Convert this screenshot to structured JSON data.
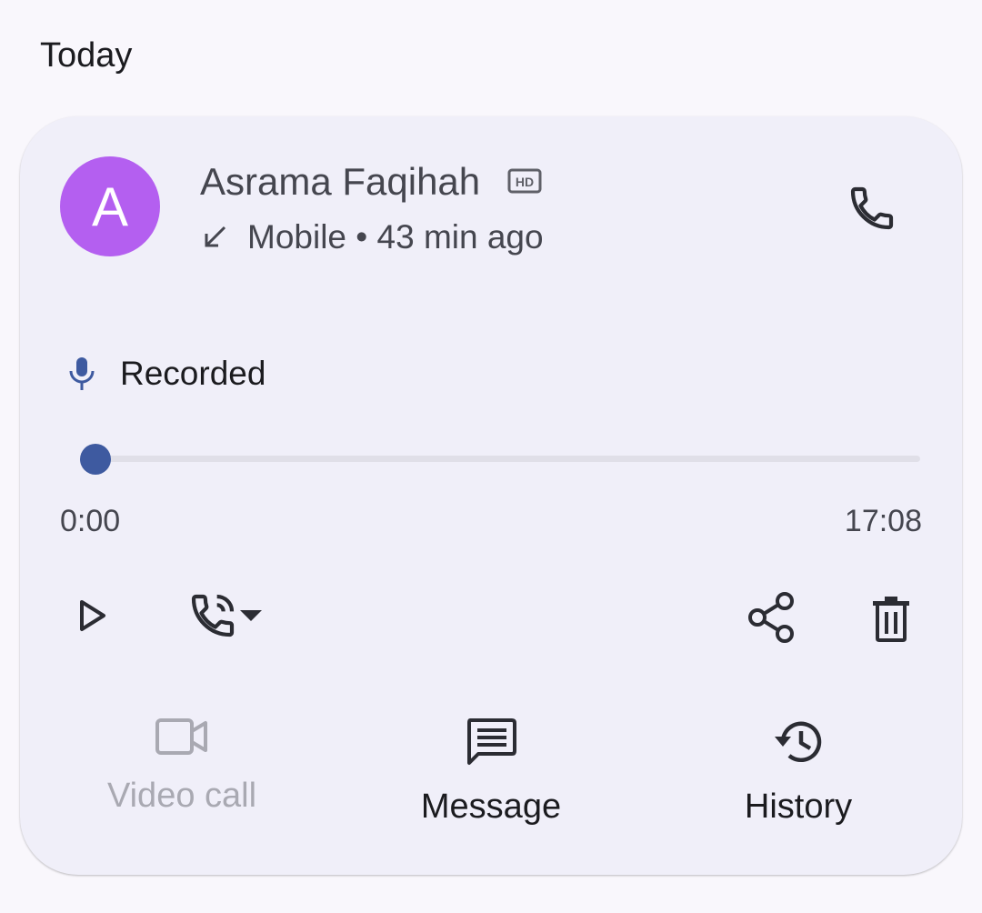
{
  "section": {
    "title": "Today"
  },
  "contact": {
    "initial": "A",
    "name": "Asrama Faqihah",
    "call_type": "Mobile • 43 min ago",
    "avatar_color": "#b45ff0"
  },
  "recording": {
    "label": "Recorded",
    "current_time": "0:00",
    "total_time": "17:08",
    "progress": 0
  },
  "controls": {
    "play": "play-icon",
    "audio_route": "phone-in-talk-icon",
    "share": "share-icon",
    "delete": "delete-icon"
  },
  "actions": [
    {
      "label": "Video call",
      "icon": "videocam-icon",
      "enabled": false
    },
    {
      "label": "Message",
      "icon": "message-icon",
      "enabled": true
    },
    {
      "label": "History",
      "icon": "history-icon",
      "enabled": true
    }
  ],
  "colors": {
    "accent": "#3e5aa0",
    "card_background": "#f0eff9",
    "page_background": "#f9f7fc",
    "disabled": "#a9a9b2"
  }
}
